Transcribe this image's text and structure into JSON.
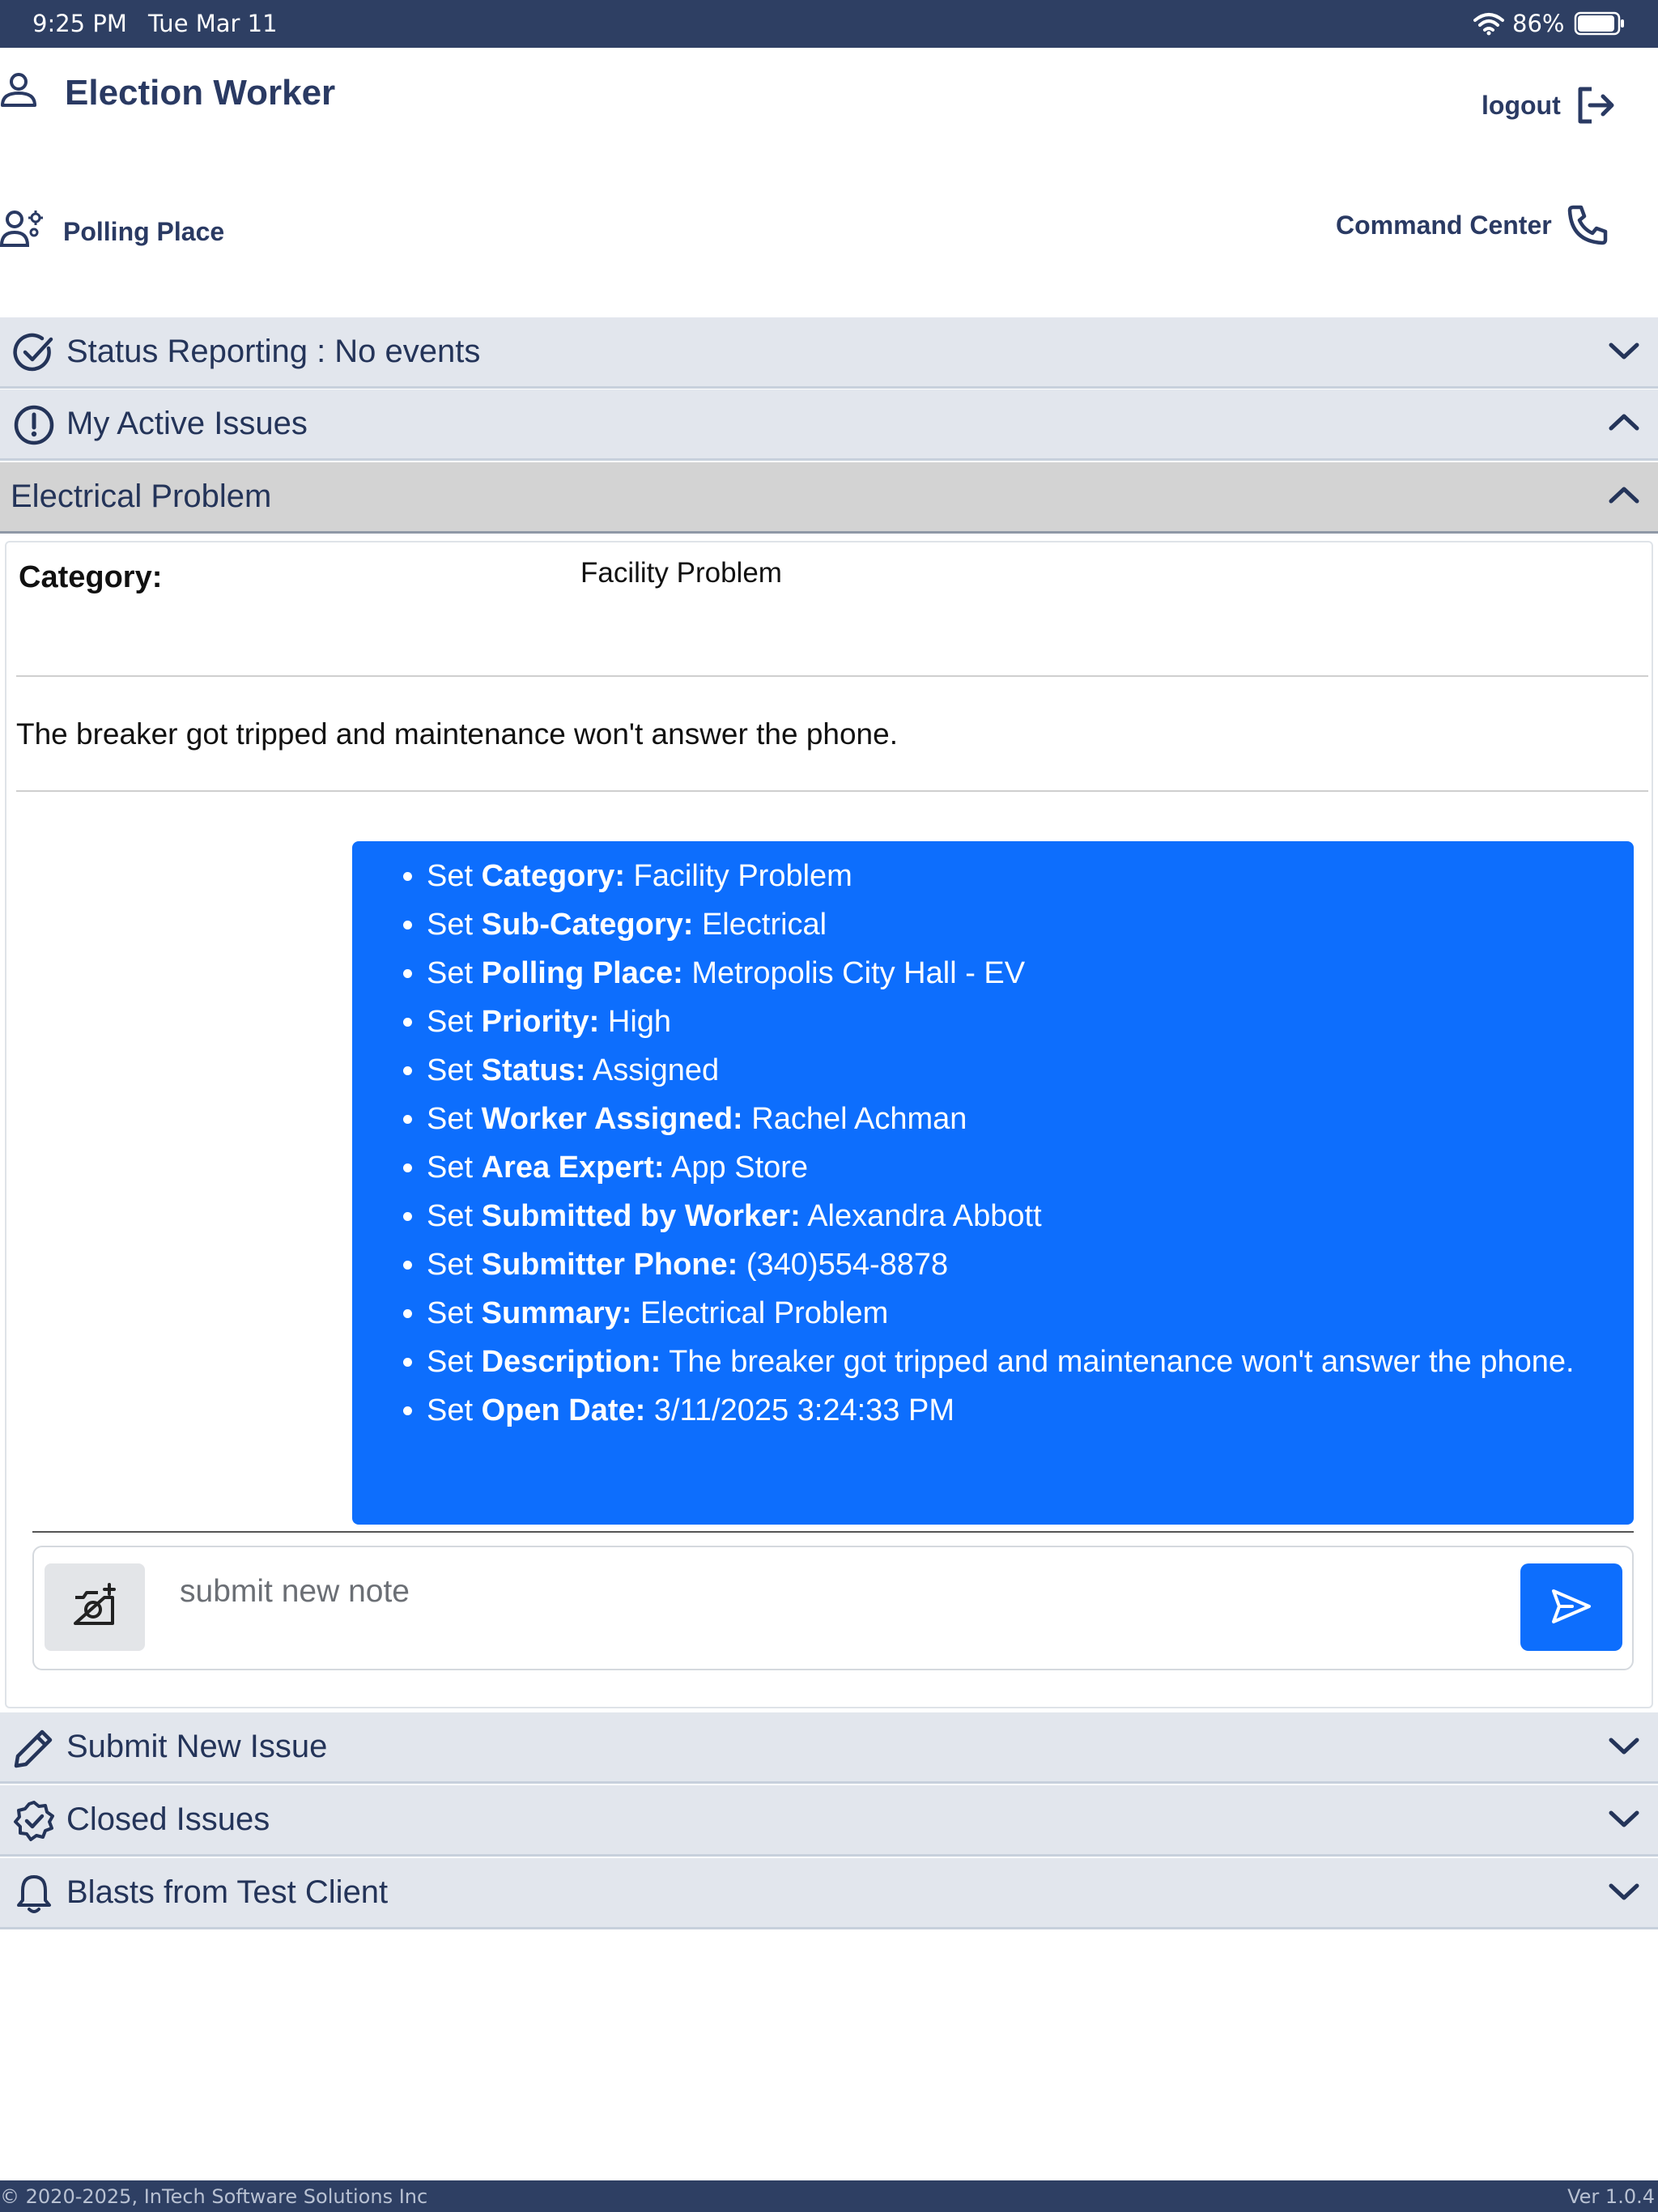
{
  "status_bar": {
    "time": "9:25 PM",
    "date": "Tue Mar 11",
    "battery": "86%"
  },
  "header": {
    "title": "Election Worker",
    "logout": "logout",
    "polling_place": "Polling Place",
    "command_center": "Command Center"
  },
  "sections": {
    "status_reporting": "Status Reporting : No events",
    "active_issues": "My Active Issues",
    "submit_new": "Submit New Issue",
    "closed": "Closed Issues",
    "blasts": "Blasts from Test Client"
  },
  "issue": {
    "title": "Electrical Problem",
    "category_label": "Category:",
    "category_value": "Facility Problem",
    "description": "The breaker got tripped and maintenance won't answer the phone.",
    "log": [
      {
        "prefix": "Set ",
        "field": "Category:",
        "value": " Facility Problem"
      },
      {
        "prefix": "Set ",
        "field": "Sub-Category:",
        "value": " Electrical"
      },
      {
        "prefix": "Set ",
        "field": "Polling Place:",
        "value": " Metropolis City Hall - EV"
      },
      {
        "prefix": "Set ",
        "field": "Priority:",
        "value": " High"
      },
      {
        "prefix": "Set ",
        "field": "Status:",
        "value": " Assigned"
      },
      {
        "prefix": "Set ",
        "field": "Worker Assigned:",
        "value": " Rachel Achman"
      },
      {
        "prefix": "Set ",
        "field": "Area Expert:",
        "value": " App Store"
      },
      {
        "prefix": "Set ",
        "field": "Submitted by Worker:",
        "value": " Alexandra Abbott"
      },
      {
        "prefix": "Set ",
        "field": "Submitter Phone:",
        "value": " (340)554-8878"
      },
      {
        "prefix": "Set ",
        "field": "Summary:",
        "value": " Electrical Problem"
      },
      {
        "prefix": "Set ",
        "field": "Description:",
        "value": " The breaker got tripped and maintenance won't answer the phone."
      },
      {
        "prefix": "Set ",
        "field": "Open Date:",
        "value": " 3/11/2025 3:24:33 PM"
      }
    ],
    "note_placeholder": "submit new note"
  },
  "footer": {
    "copyright": "© 2020-2025, InTech Software Solutions Inc",
    "version": "Ver 1.0.4"
  },
  "colors": {
    "header_bar": "#2e3f63",
    "accent": "#0d6efd",
    "section_bg": "#e2e6ed",
    "text": "#243459"
  }
}
